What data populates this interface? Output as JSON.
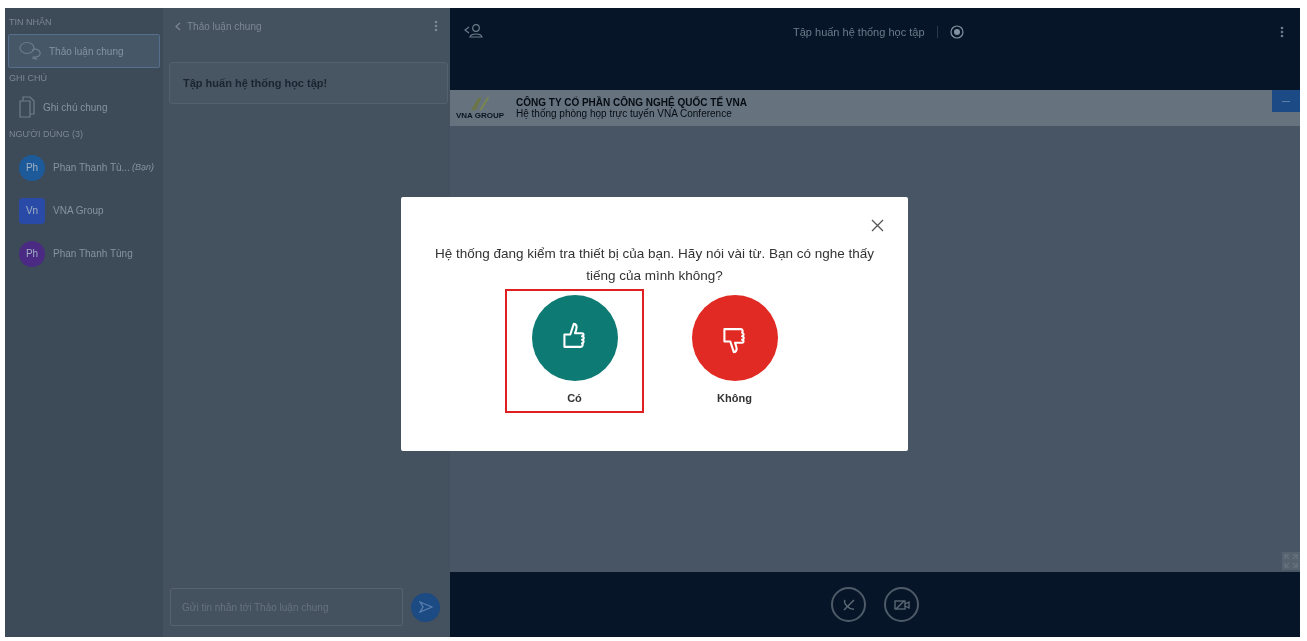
{
  "sidebar": {
    "sections": [
      {
        "heading": "TIN NHẮN",
        "items": [
          {
            "kind": "chat",
            "label": "Thảo luận chung",
            "selected": true
          }
        ]
      },
      {
        "heading": "GHI CHÚ",
        "items": [
          {
            "kind": "note",
            "label": "Ghi chú chung",
            "selected": false
          }
        ]
      },
      {
        "heading": "NGƯỜI DÙNG (3)",
        "items": [
          {
            "kind": "user",
            "avatar": "Ph",
            "color": "#1d5a9a",
            "label": "Phan Thanh Tù...",
            "suffix": "(Bạn)",
            "selected": false
          },
          {
            "kind": "user",
            "avatar": "Vn",
            "color": "#2a4aa8",
            "label": "VNA Group",
            "selected": false
          },
          {
            "kind": "user",
            "avatar": "Ph",
            "color": "#4a2a82",
            "label": "Phan Thanh Tùng",
            "selected": false
          }
        ]
      }
    ]
  },
  "chat": {
    "title": "Thảo luận chung",
    "messages": [
      "Tập huấn hệ thống học tập!"
    ],
    "input": {
      "placeholder": "Gửi tin nhắn tới Thảo luận chung"
    }
  },
  "meeting": {
    "title": "Tập huấn hệ thống học tập",
    "banner": {
      "company": "CÔNG TY CỔ PHẦN CÔNG NGHỆ QUỐC TẾ VNA",
      "subtitle": "Hệ thống phòng họp trực tuyến VNA Conference",
      "logo_caption": "VNA GROUP"
    }
  },
  "dialog": {
    "prompt": "Hệ thống đang kiểm tra thiết bị của bạn. Hãy nói vài từ. Bạn có nghe thấy tiếng của mình không?",
    "answers": [
      {
        "kind": "yes",
        "label": "Có",
        "highlighted": true
      },
      {
        "kind": "no",
        "label": "Không",
        "highlighted": false
      }
    ]
  }
}
